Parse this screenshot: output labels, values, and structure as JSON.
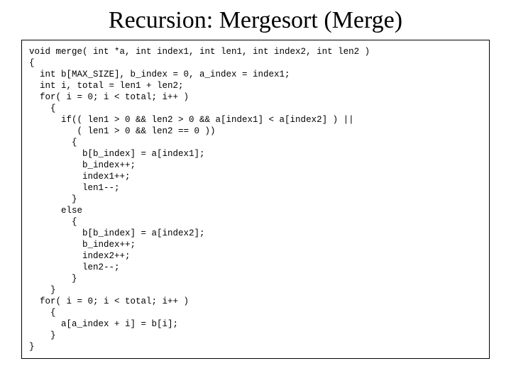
{
  "title": "Recursion: Mergesort (Merge)",
  "code": "void merge( int *a, int index1, int len1, int index2, int len2 )\n{\n  int b[MAX_SIZE], b_index = 0, a_index = index1;\n  int i, total = len1 + len2;\n  for( i = 0; i < total; i++ )\n    {\n      if(( len1 > 0 && len2 > 0 && a[index1] < a[index2] ) ||\n         ( len1 > 0 && len2 == 0 ))\n        {\n          b[b_index] = a[index1];\n          b_index++;\n          index1++;\n          len1--;\n        }\n      else\n        {\n          b[b_index] = a[index2];\n          b_index++;\n          index2++;\n          len2--;\n        }\n    }\n  for( i = 0; i < total; i++ )\n    {\n      a[a_index + i] = b[i];\n    }\n}"
}
